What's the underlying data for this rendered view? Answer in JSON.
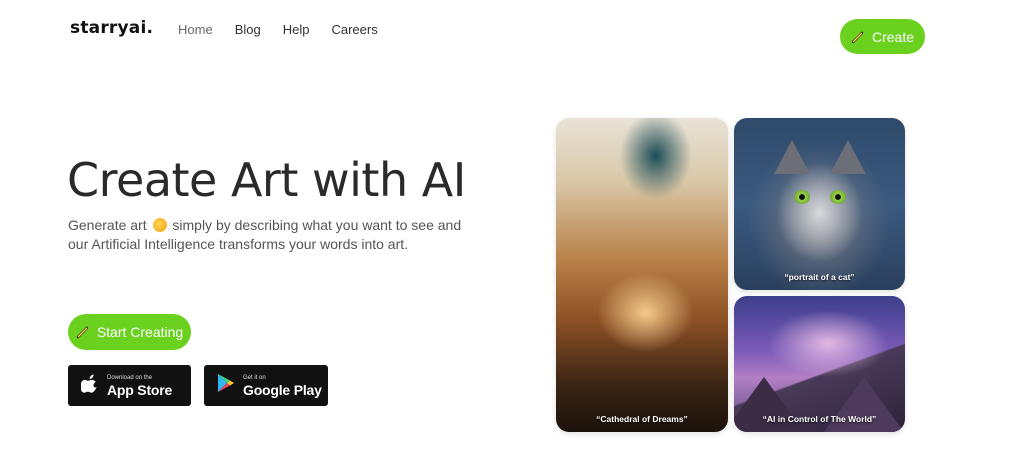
{
  "brand": {
    "logo": "starryai."
  },
  "nav": {
    "items": [
      "Home",
      "Blog",
      "Help",
      "Careers"
    ]
  },
  "header": {
    "create_label": "Create"
  },
  "hero": {
    "title": "Create Art with AI",
    "desc_part1": "Generate art",
    "desc_part2": "simply by describing what you want to see and our Artificial Intelligence transforms your words into art.",
    "start_label": "Start Creating"
  },
  "stores": {
    "apple": {
      "small": "Download on the",
      "big": "App Store"
    },
    "google": {
      "small": "Get it on",
      "big": "Google Play"
    }
  },
  "gallery": {
    "captions": [
      "“Cathedral of Dreams”",
      "“portrait of a cat”",
      "“AI in Control of The World”"
    ]
  },
  "colors": {
    "accent": "#6bd11f",
    "text_dark": "#2a2a2a",
    "store_bg": "#111111"
  },
  "icons": [
    "pen-icon",
    "apple-icon",
    "google-play-icon",
    "palette-emoji-icon"
  ]
}
